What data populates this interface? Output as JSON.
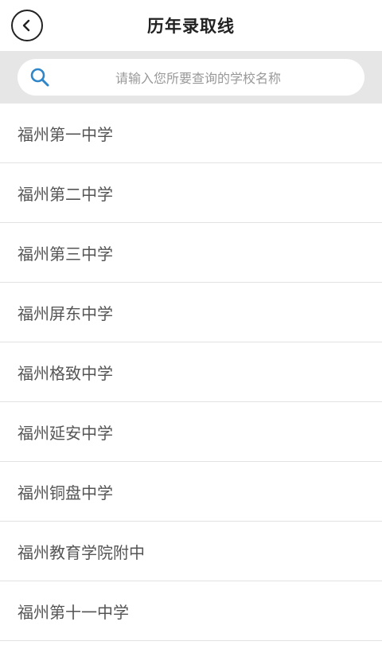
{
  "header": {
    "title": "历年录取线",
    "back_icon": "chevron-left-icon"
  },
  "search": {
    "placeholder": "请输入您所要查询的学校名称",
    "icon": "search-icon",
    "icon_color": "#2f86c8"
  },
  "schools": [
    {
      "name": "福州第一中学"
    },
    {
      "name": "福州第二中学"
    },
    {
      "name": "福州第三中学"
    },
    {
      "name": "福州屏东中学"
    },
    {
      "name": "福州格致中学"
    },
    {
      "name": "福州延安中学"
    },
    {
      "name": "福州铜盘中学"
    },
    {
      "name": "福州教育学院附中"
    },
    {
      "name": "福州第十一中学"
    }
  ]
}
